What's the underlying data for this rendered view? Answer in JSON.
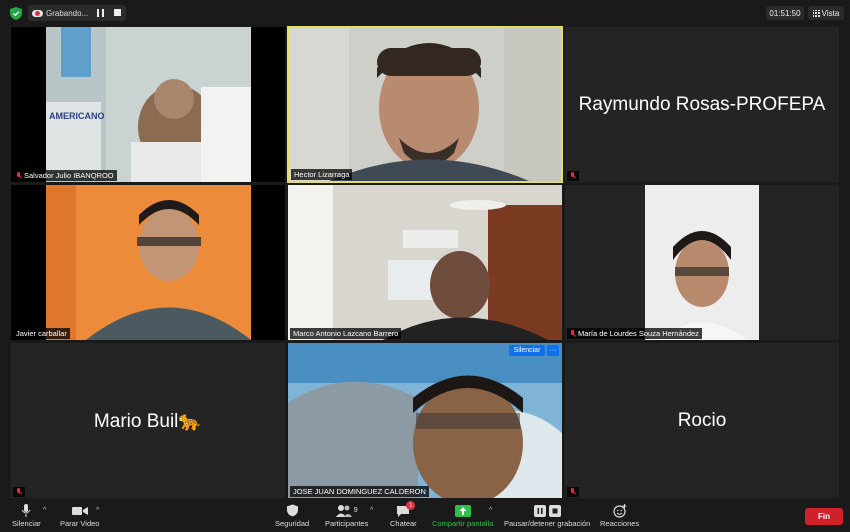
{
  "topbar": {
    "recording_label": "Grabando...",
    "timer": "01:51:50",
    "view_label": "Vista"
  },
  "tiles": {
    "t1": {
      "name": "Salvador Julio IBANQROO"
    },
    "t2": {
      "name": "Hector Lizarraga"
    },
    "t3": {
      "name": "Raymundo Rosas-PROFEPA"
    },
    "t4": {
      "name": "Javier carballar"
    },
    "t5": {
      "name": "Marco Antonio Lazcano Barrero"
    },
    "t6": {
      "name": "María de Lourdes Souza Hernández"
    },
    "t7": {
      "name": "Mario Buil🐆"
    },
    "t8": {
      "name": "JOSE JUAN DOMINGUEZ CALDERON",
      "mute_label": "Silenciar",
      "more_label": "···"
    },
    "t9": {
      "name": "Rocio"
    }
  },
  "toolbar": {
    "mute": "Silenciar",
    "video": "Parar Video",
    "security": "Seguridad",
    "participants": "Participantes",
    "participants_count": "9",
    "chat": "Chatear",
    "chat_badge": "1",
    "share": "Compartir pantalla",
    "record": "Pausar/detener grabación",
    "reactions": "Reacciones",
    "end": "Fin"
  },
  "colors": {
    "active_speaker": "#e3e061",
    "end": "#d0202a",
    "share": "#2fbf4a",
    "accent": "#0e71eb"
  }
}
